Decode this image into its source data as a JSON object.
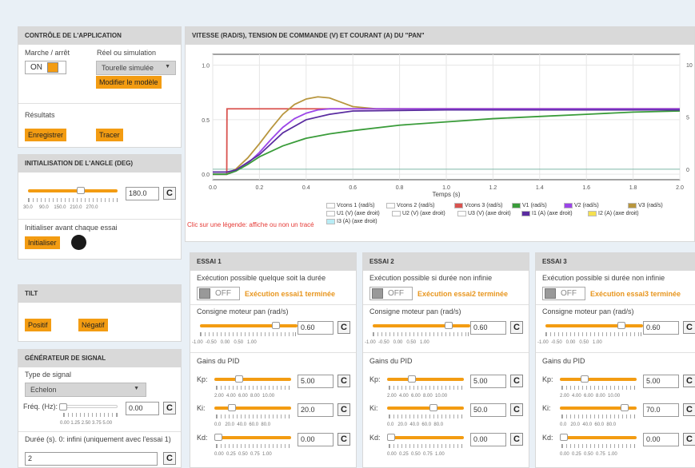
{
  "app": {
    "title": "CONTRÔLE DE L'APPLICATION",
    "run_label": "Marche / arrêt",
    "mode_label": "Réel ou simulation",
    "on_label": "ON",
    "mode_value": "Tourelle simulée",
    "modify_btn": "Modifier le modèle",
    "results_label": "Résultats",
    "save_btn": "Enregistrer",
    "plot_btn": "Tracer"
  },
  "angle": {
    "title": "INITIALISATION DE L'ANGLE (DEG)",
    "value": "180.0",
    "ticks": [
      "30.0",
      "90.0",
      "150.0",
      "210.0",
      "270.0"
    ],
    "init_label": "Initialiser avant chaque essai",
    "init_btn": "Initialiser",
    "slider_level": 0.6
  },
  "tilt": {
    "title": "TILT",
    "pos_btn": "Positif",
    "neg_btn": "Négatif"
  },
  "gen": {
    "title": "GÉNÉRATEUR DE SIGNAL",
    "type_label": "Type de signal",
    "type_value": "Echelon",
    "freq_label": "Fréq. (Hz):",
    "freq_value": "0.00",
    "freq_ticks": "0.00 1.25 2.50 3.75 5.00",
    "duration_label": "Durée (s). 0: infini (uniquement avec l'essai 1)",
    "duration_value": "2"
  },
  "plot": {
    "title": "VITESSE (RAD/S), TENSION DE COMMANDE (V) ET COURANT (A) DU \"PAN\"",
    "hint": "Clic sur une légende: affiche ou non un tracé",
    "legend": [
      {
        "label": "Vcons 1 (rad/s)",
        "color": "#ffffff"
      },
      {
        "label": "Vcons 2 (rad/s)",
        "color": "#ffffff"
      },
      {
        "label": "Vcons 3 (rad/s)",
        "color": "#d9534f"
      },
      {
        "label": "V1 (rad/s)",
        "color": "#3a9c3a"
      },
      {
        "label": "V2 (rad/s)",
        "color": "#9b45e8"
      },
      {
        "label": "V3 (rad/s)",
        "color": "#b8963e"
      },
      {
        "label": "U1 (V) (axe droit)",
        "color": "#ffffff"
      },
      {
        "label": "U2 (V) (axe droit)",
        "color": "#ffffff"
      },
      {
        "label": "U3 (V) (axe droit)",
        "color": "#ffffff"
      },
      {
        "label": "I1 (A) (axe droit)",
        "color": "#5a2ca0"
      },
      {
        "label": "I2 (A) (axe droit)",
        "color": "#f5e050"
      },
      {
        "label": "I3 (A) (axe droit)",
        "color": "#b8ecf5"
      }
    ]
  },
  "chart_data": {
    "type": "line",
    "xlabel": "Temps (s)",
    "xlim": [
      0,
      2
    ],
    "ylim": [
      -0.05,
      1.1
    ],
    "y2lim": [
      -1,
      11
    ],
    "xticks": [
      "0.0",
      "0.2",
      "0.4",
      "0.6",
      "0.8",
      "1.0",
      "1.2",
      "1.4",
      "1.6",
      "1.8",
      "2.0"
    ],
    "yticks": [
      "0.0",
      "0.5",
      "1.0"
    ],
    "y2ticks": [
      "0",
      "5",
      "10"
    ],
    "series": [
      {
        "name": "Vcons 3 (rad/s)",
        "color": "#d9534f",
        "x": [
          0,
          0.06,
          0.061,
          2.0
        ],
        "y": [
          0,
          0,
          0.6,
          0.6
        ]
      },
      {
        "name": "V3 (rad/s)",
        "color": "#b8963e",
        "x": [
          0,
          0.06,
          0.1,
          0.15,
          0.2,
          0.25,
          0.3,
          0.35,
          0.4,
          0.45,
          0.5,
          0.55,
          0.6,
          0.7,
          0.8,
          1.0,
          1.5,
          2.0
        ],
        "y": [
          0,
          0,
          0.05,
          0.15,
          0.28,
          0.42,
          0.55,
          0.64,
          0.69,
          0.71,
          0.7,
          0.66,
          0.62,
          0.6,
          0.6,
          0.6,
          0.6,
          0.6
        ]
      },
      {
        "name": "V2 (rad/s)",
        "color": "#9b45e8",
        "x": [
          0,
          0.06,
          0.1,
          0.15,
          0.2,
          0.25,
          0.3,
          0.35,
          0.4,
          0.45,
          0.5,
          0.55,
          0.6,
          0.8,
          1.0,
          1.5,
          2.0
        ],
        "y": [
          0,
          0,
          0.03,
          0.1,
          0.2,
          0.32,
          0.43,
          0.51,
          0.56,
          0.59,
          0.6,
          0.6,
          0.6,
          0.6,
          0.6,
          0.6,
          0.6
        ]
      },
      {
        "name": "V1 (rad/s)",
        "color": "#3a9c3a",
        "x": [
          0,
          0.06,
          0.1,
          0.15,
          0.2,
          0.3,
          0.4,
          0.5,
          0.6,
          0.8,
          1.0,
          1.2,
          1.4,
          1.6,
          1.8,
          2.0
        ],
        "y": [
          0,
          0,
          0.03,
          0.09,
          0.16,
          0.26,
          0.33,
          0.37,
          0.4,
          0.45,
          0.48,
          0.51,
          0.53,
          0.55,
          0.57,
          0.58
        ]
      },
      {
        "name": "I1 (A) (axe droit)",
        "color": "#5a2ca0",
        "x": [
          0,
          0.06,
          0.1,
          0.2,
          0.3,
          0.4,
          0.5,
          0.6,
          1.0,
          1.5,
          2.0
        ],
        "y": [
          0.02,
          0.02,
          0.04,
          0.18,
          0.38,
          0.5,
          0.55,
          0.58,
          0.59,
          0.59,
          0.59
        ]
      }
    ]
  },
  "trials": [
    {
      "title": "ESSAI 1",
      "exec_label": "Exécution possible quelque soit la durée",
      "off": "OFF",
      "done": "Exécution essai1 terminée",
      "consigne_label": "Consigne moteur pan (rad/s)",
      "consigne": "0.60",
      "consigne_level": 0.8,
      "gains_label": "Gains du PID",
      "kp": "5.00",
      "kp_level": 0.3,
      "ki": "20.0",
      "ki_level": 0.2,
      "kd": "0.00",
      "kd_level": 0.0
    },
    {
      "title": "ESSAI 2",
      "exec_label": "Exécution possible si durée non infinie",
      "off": "OFF",
      "done": "Exécution essai2 terminée",
      "consigne_label": "Consigne moteur pan (rad/s)",
      "consigne": "0.60",
      "consigne_level": 0.8,
      "gains_label": "Gains du PID",
      "kp": "5.00",
      "kp_level": 0.3,
      "ki": "50.0",
      "ki_level": 0.62,
      "kd": "0.00",
      "kd_level": 0.0
    },
    {
      "title": "ESSAI 3",
      "exec_label": "Exécution possible si durée non infinie",
      "off": "OFF",
      "done": "Exécution essai3 terminée",
      "consigne_label": "Consigne moteur pan (rad/s)",
      "consigne": "0.60",
      "consigne_level": 0.8,
      "gains_label": "Gains du PID",
      "kp": "5.00",
      "kp_level": 0.3,
      "ki": "70.0",
      "ki_level": 0.88,
      "kd": "0.00",
      "kd_level": 0.0
    }
  ],
  "trial_labels": {
    "kp": "Kp:",
    "ki": "Ki:",
    "kd": "Kd:",
    "refresh_icon": "refresh-icon"
  },
  "ticks": {
    "consigne": "-1.00  -0.50   0.00   0.50   1.00",
    "kp": "2.00  4.00  6.00  8.00  10.00",
    "ki": "0.0   20.0  40.0  60.0  80.0",
    "kd": "0.00  0.25  0.50  0.75  1.00"
  },
  "colors": {
    "accent": "#f39c12"
  }
}
